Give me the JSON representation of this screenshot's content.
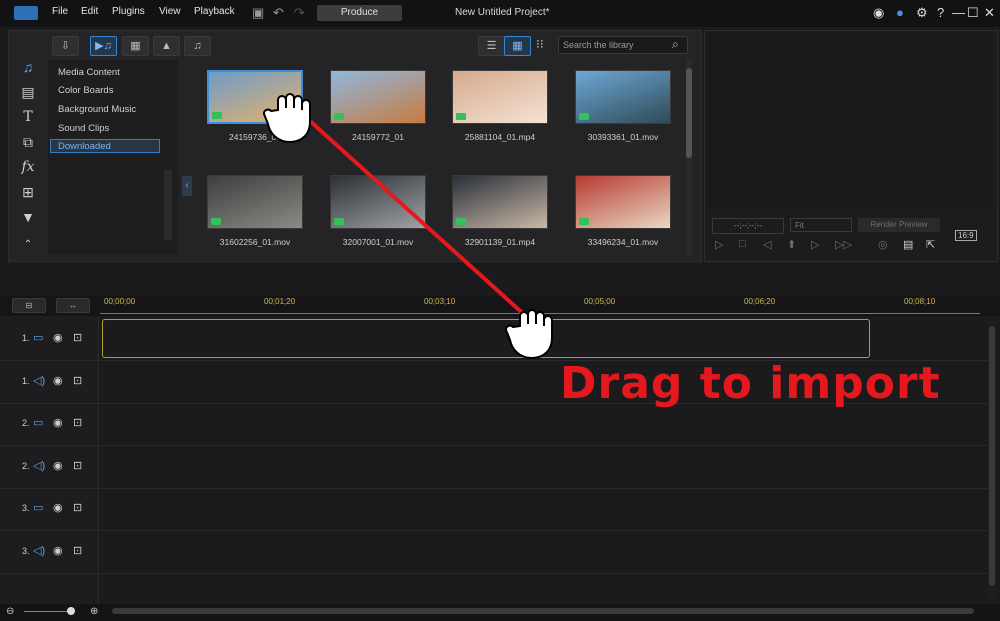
{
  "menu": [
    "File",
    "Edit",
    "Plugins",
    "View",
    "Playback"
  ],
  "produce_label": "Produce",
  "project_title": "New Untitled Project*",
  "search": {
    "placeholder": "Search the library"
  },
  "nav_items": [
    "Media Content",
    "Color Boards",
    "Background Music",
    "Sound Clips",
    "Downloaded"
  ],
  "media": [
    {
      "name": "24159736_01",
      "colors": [
        "#6d9cc8",
        "#e7b16b"
      ]
    },
    {
      "name": "24159772_01",
      "colors": [
        "#8fb7de",
        "#c87b41"
      ]
    },
    {
      "name": "25881104_01.mp4",
      "colors": [
        "#d7a98c",
        "#f3e3d4"
      ]
    },
    {
      "name": "30393361_01.mov",
      "colors": [
        "#6fa8d6",
        "#2f4a57"
      ]
    },
    {
      "name": "31602256_01.mov",
      "colors": [
        "#3e3e3e",
        "#8a8a85"
      ]
    },
    {
      "name": "32007001_01.mov",
      "colors": [
        "#2c2f33",
        "#9fa3a8"
      ]
    },
    {
      "name": "32901139_01.mp4",
      "colors": [
        "#2a2f3a",
        "#c9b8a6"
      ]
    },
    {
      "name": "33496234_01.mov",
      "colors": [
        "#b83a32",
        "#e8d8c2"
      ]
    }
  ],
  "preview": {
    "timecode": "--;--;--;--",
    "fit": "Fit",
    "render": "Render Preview",
    "aspect": "16:9"
  },
  "ruler_ticks": [
    "00;00;00",
    "00;01;20",
    "00;03;10",
    "00;05;00",
    "00;06;20",
    "00;08;10"
  ],
  "tracks": [
    "1.",
    "1.",
    "2.",
    "2.",
    "3.",
    "3."
  ],
  "overlay_text": "Drag to import"
}
